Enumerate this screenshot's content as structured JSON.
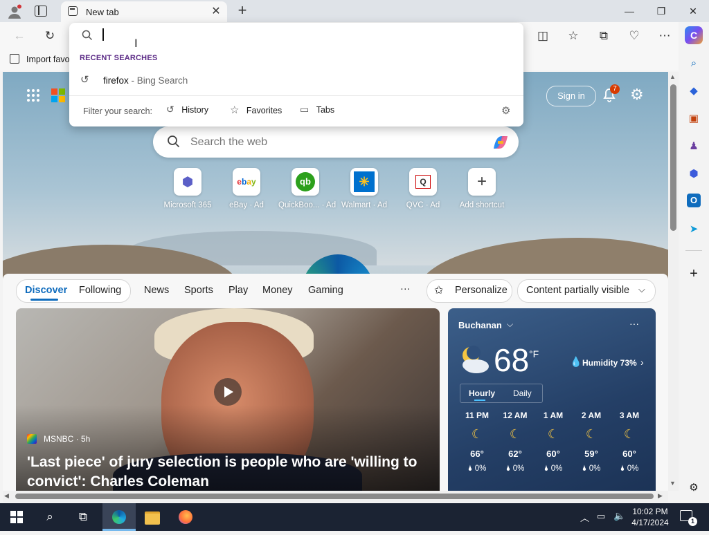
{
  "browser": {
    "tab_title": "New tab",
    "favorites_bar_item": "Import favo"
  },
  "dropdown": {
    "section_title": "RECENT SEARCHES",
    "recent_query": "firefox",
    "recent_suffix": " - Bing Search",
    "filter_label": "Filter your search:",
    "filters": [
      "History",
      "Favorites",
      "Tabs"
    ]
  },
  "page_header": {
    "sign_in": "Sign in",
    "notification_count": "7"
  },
  "search": {
    "placeholder": "Search the web"
  },
  "shortcuts": [
    {
      "label": "Microsoft 365",
      "icon": "microsoft-365-icon"
    },
    {
      "label": "eBay · Ad",
      "icon": "ebay-icon"
    },
    {
      "label": "QuickBoo... · Ad",
      "icon": "quickbooks-icon"
    },
    {
      "label": "Walmart · Ad",
      "icon": "walmart-icon"
    },
    {
      "label": "QVC · Ad",
      "icon": "qvc-icon"
    },
    {
      "label": "Add shortcut",
      "icon": "plus-icon"
    }
  ],
  "feed_nav": {
    "tabs": [
      "Discover",
      "Following"
    ],
    "categories": [
      "News",
      "Sports",
      "Play",
      "Money",
      "Gaming"
    ],
    "more": "···",
    "personalize": "Personalize",
    "content_visibility": "Content partially visible"
  },
  "news": {
    "source": "MSNBC",
    "age": " · 5h",
    "headline": "'Last piece' of jury selection is people who are 'willing to convict': Charles Coleman"
  },
  "weather": {
    "location": "Buchanan",
    "temp": "68",
    "unit": "°F",
    "humidity": "Humidity 73%",
    "tabs": [
      "Hourly",
      "Daily"
    ],
    "hours": [
      {
        "time": "11 PM",
        "temp": "66°",
        "precip": "0%"
      },
      {
        "time": "12 AM",
        "temp": "62°",
        "precip": "0%"
      },
      {
        "time": "1 AM",
        "temp": "60°",
        "precip": "0%"
      },
      {
        "time": "2 AM",
        "temp": "59°",
        "precip": "0%"
      },
      {
        "time": "3 AM",
        "temp": "60°",
        "precip": "0%"
      }
    ]
  },
  "taskbar": {
    "time": "10:02 PM",
    "date": "4/17/2024",
    "notification_badge": "1"
  },
  "colors": {
    "accent": "#0f6cbd",
    "discover_underline": "#0f6cbd",
    "notification_badge": "#d83b01"
  }
}
